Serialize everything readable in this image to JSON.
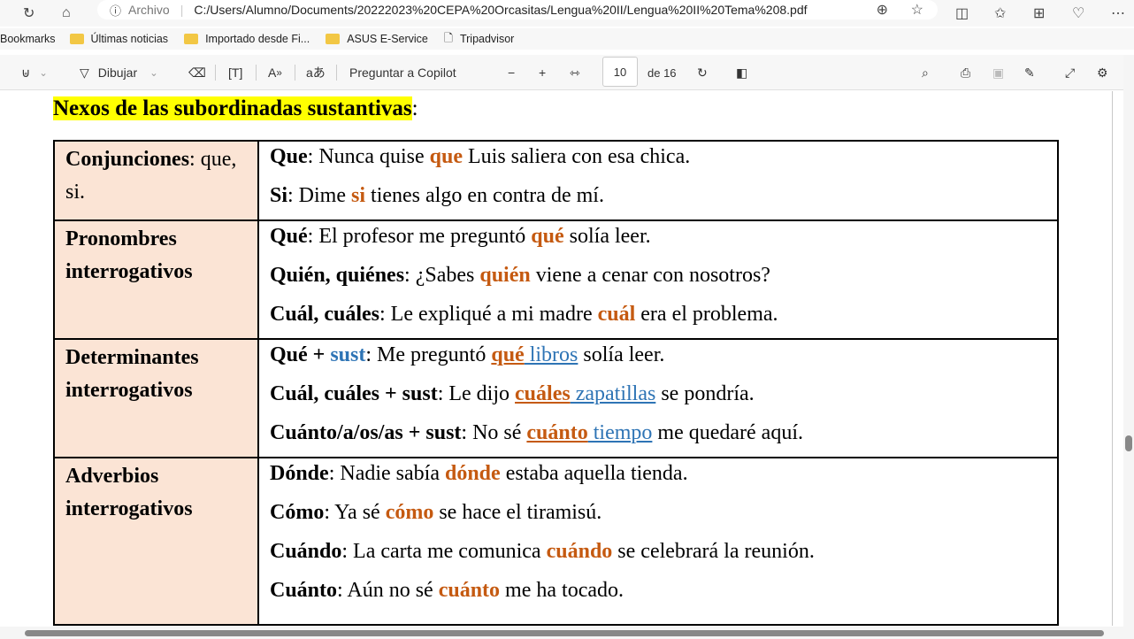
{
  "browser": {
    "archivo": "Archivo",
    "url": "C:/Users/Alumno/Documents/20222023%20CEPA%20Orcasitas/Lengua%20II/Lengua%20II%20Tema%208.pdf"
  },
  "bookmarks": {
    "label": "Bookmarks",
    "items": [
      "Últimas noticias",
      "Importado desde Fi...",
      "ASUS E-Service",
      "Tripadvisor"
    ]
  },
  "toolbar": {
    "draw": "Dibujar",
    "copilot": "Preguntar a Copilot",
    "page": "10",
    "of": "de 16"
  },
  "doc": {
    "title": "Nexos de las subordinadas sustantivas",
    "title_colon": ":",
    "rows": [
      {
        "label": [
          "Conjunciones",
          ": que, si."
        ],
        "lines": [
          [
            [
              "Que",
              "b"
            ],
            [
              ": Nunca quise ",
              "n"
            ],
            [
              "que",
              "o"
            ],
            [
              " Luis saliera con esa chica.",
              "n"
            ]
          ],
          [
            [
              "Si",
              "b"
            ],
            [
              ": Dime ",
              "n"
            ],
            [
              "si",
              "o"
            ],
            [
              " tienes algo en contra de mí.",
              "n"
            ]
          ]
        ]
      },
      {
        "label": [
          "Pronombres interrogativos",
          ""
        ],
        "lines": [
          [
            [
              "Qué",
              "b"
            ],
            [
              ": El profesor me preguntó ",
              "n"
            ],
            [
              "qué",
              "o"
            ],
            [
              " solía leer.",
              "n"
            ]
          ],
          [
            [
              "Quién, quiénes",
              "b"
            ],
            [
              ": ¿Sabes ",
              "n"
            ],
            [
              "quién",
              "o"
            ],
            [
              " viene a cenar con nosotros?",
              "n"
            ]
          ],
          [
            [
              "Cuál, cuáles",
              "b"
            ],
            [
              ": Le expliqué a mi madre ",
              "n"
            ],
            [
              "cuál",
              "o"
            ],
            [
              " era el problema.",
              "n"
            ]
          ]
        ]
      },
      {
        "label": [
          "Determinantes interrogativos",
          ""
        ],
        "lines": [
          [
            [
              "Qué + ",
              "b"
            ],
            [
              "sust",
              "bl"
            ],
            [
              ": Me preguntó ",
              "n"
            ],
            [
              "qué",
              "o u"
            ],
            [
              " libros",
              "blu u"
            ],
            [
              " solía leer.",
              "n"
            ]
          ],
          [
            [
              "Cuál, cuáles + sust",
              "b"
            ],
            [
              ": Le dijo ",
              "n"
            ],
            [
              "cuáles",
              "o u"
            ],
            [
              " zapatillas",
              "blu u"
            ],
            [
              " se pondría.",
              "n"
            ]
          ],
          [
            [
              "Cuánto/a/os/as + sust",
              "b"
            ],
            [
              ": No sé ",
              "n"
            ],
            [
              "cuánto",
              "o u"
            ],
            [
              " tiempo",
              "blu u"
            ],
            [
              " me quedaré aquí.",
              "n"
            ]
          ]
        ]
      },
      {
        "label": [
          "Adverbios interrogativos",
          ""
        ],
        "lines": [
          [
            [
              "Dónde",
              "b"
            ],
            [
              ": Nadie sabía ",
              "n"
            ],
            [
              "dónde",
              "o"
            ],
            [
              " estaba aquella tienda.",
              "n"
            ]
          ],
          [
            [
              "Cómo",
              "b"
            ],
            [
              ": Ya sé ",
              "n"
            ],
            [
              "cómo",
              "o"
            ],
            [
              " se hace el tiramisú.",
              "n"
            ]
          ],
          [
            [
              "Cuándo",
              "b"
            ],
            [
              ": La carta me comunica ",
              "n"
            ],
            [
              "cuándo",
              "o"
            ],
            [
              " se celebrará la reunión.",
              "n"
            ]
          ],
          [
            [
              "Cuánto",
              "b"
            ],
            [
              ": Aún no sé ",
              "n"
            ],
            [
              "cuánto",
              "o"
            ],
            [
              " me ha tocado.",
              "n"
            ]
          ]
        ]
      }
    ]
  }
}
